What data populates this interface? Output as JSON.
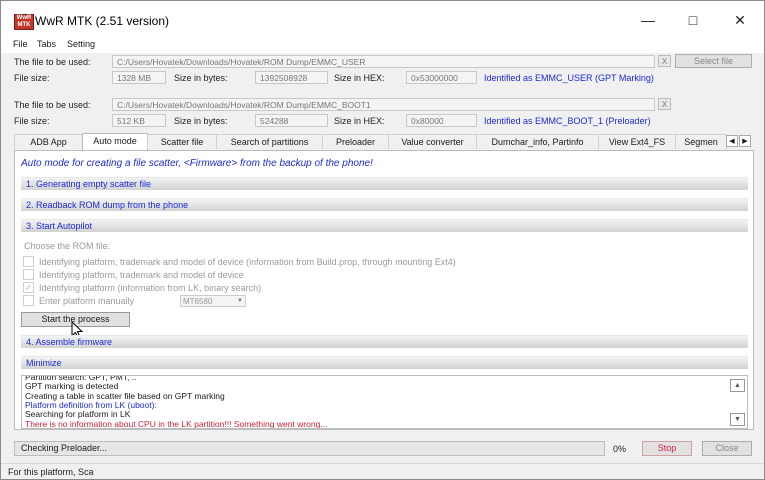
{
  "window": {
    "title": "WwR MTK (2.51 version)",
    "icon_text": "WwR MTK"
  },
  "menu": [
    "File",
    "Tabs",
    "Setting"
  ],
  "file1": {
    "label": "The file to be used:",
    "path": "C:/Users/Hovatek/Downloads/Hovatek/ROM Dump/EMMC_USER",
    "size_label": "File size:",
    "size": "1328 MB",
    "bytes_label": "Size in bytes:",
    "bytes": "1392508928",
    "hex_label": "Size in HEX:",
    "hex": "0x53000000",
    "identified": "Identified as EMMC_USER (GPT Marking)",
    "clear": "X",
    "select": "Select file"
  },
  "file2": {
    "label": "The file to be used:",
    "path": "C:/Users/Hovatek/Downloads/Hovatek/ROM Dump/EMMC_BOOT1",
    "size_label": "File size:",
    "size": "512 KB",
    "bytes_label": "Size in bytes:",
    "bytes": "524288",
    "hex_label": "Size in HEX:",
    "hex": "0x80000",
    "identified": "Identified as EMMC_BOOT_1 (Preloader)",
    "clear": "X"
  },
  "tabs": [
    "ADB App",
    "Auto mode",
    "Scatter file",
    "Search of partitions",
    "Preloader",
    "Value converter",
    "Dumchar_info, Partinfo",
    "View Ext4_FS",
    "Segmen"
  ],
  "auto": {
    "heading": "Auto mode for creating a file scatter, <Firmware> from the backup of the phone!",
    "step1": "1. Generating empty scatter file",
    "step2": "2. Readback ROM dump from the phone",
    "step3": "3. Start Autopilot",
    "choose": "Choose the ROM file:",
    "options": [
      "Identifying platform, trademark and model of device (information from Build.prop, through mounting Ext4)",
      "Identifying platform, trademark and model of device",
      "Identifying platform (information from LK, binary search)",
      "Enter platform manually"
    ],
    "platform": "MT6580",
    "start": "Start the process",
    "step4": "4. Assemble firmware",
    "minimize": "Minimize"
  },
  "log": [
    {
      "text": "Partition search: GPT, PMT, ..",
      "color": "#1a1a1a"
    },
    {
      "text": "GPT marking is detected",
      "color": "#1a1a1a"
    },
    {
      "text": "Creating a table in scatter file based on GPT marking",
      "color": "#1a1a1a"
    },
    {
      "text": "Platform definition from LK (uboot):",
      "color": "#1c2ad6"
    },
    {
      "text": "Searching for platform in LK",
      "color": "#1a1a1a"
    },
    {
      "text": "There is no information about CPU in the LK partition!!! Something went wrong...",
      "color": "#d2233a"
    }
  ],
  "progress": {
    "text": "Checking Preloader...",
    "percent": "0%",
    "stop": "Stop",
    "close": "Close"
  },
  "status": "For this platform, Sca",
  "colors": {
    "accent": "#1c2ad6",
    "error": "#d2233a",
    "stop": "#d2233a"
  }
}
